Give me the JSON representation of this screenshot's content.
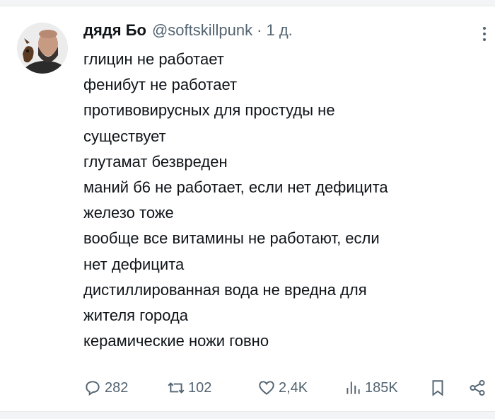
{
  "tweet": {
    "author_name": "дядя Бо",
    "author_handle": "@softskillpunk",
    "separator": "·",
    "time": "1 д.",
    "lines": [
      "глицин не работает",
      "фенибут не работает",
      "противовирусных для простуды не",
      "существует",
      "глутамат безвреден",
      "маний б6 не работает, если нет дефицита",
      "железо тоже",
      "вообще все витамины не работают, если",
      "нет дефицита",
      "дистиллированная вода не вредна для",
      "жителя города",
      "керамические ножи говно"
    ]
  },
  "actions": {
    "replies": "282",
    "reposts": "102",
    "likes": "2,4K",
    "views": "185K"
  },
  "icons": {
    "more": "more-vertical-icon",
    "reply": "reply-icon",
    "repost": "repost-icon",
    "like": "heart-icon",
    "views": "views-icon",
    "bookmark": "bookmark-icon",
    "share": "share-icon"
  }
}
